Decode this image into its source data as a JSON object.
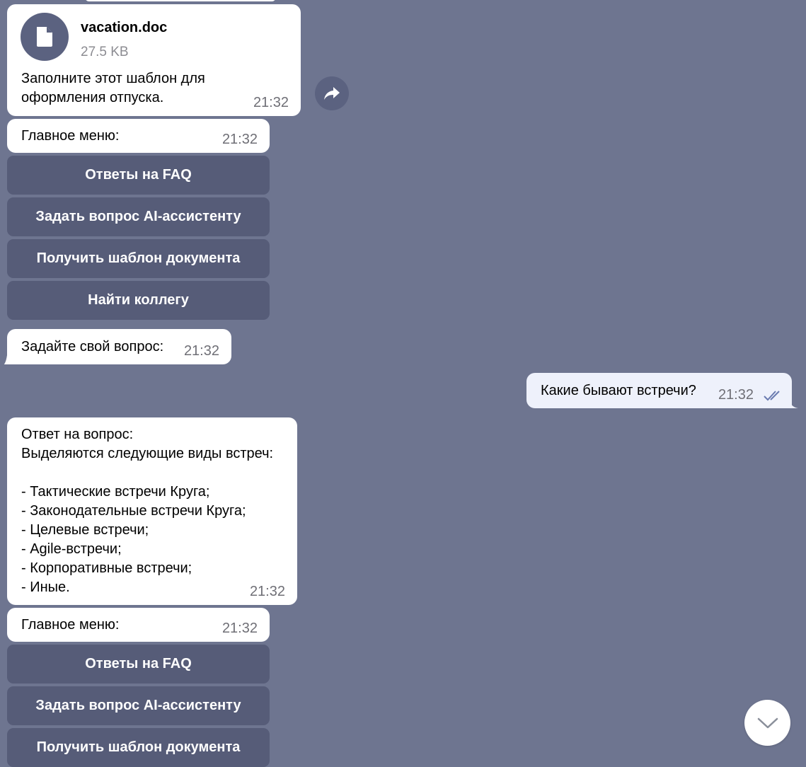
{
  "file_message": {
    "file_name": "vacation.doc",
    "file_size": "27.5 KB",
    "caption": "Заполните этот шаблон для\nоформления отпуска.",
    "time": "21:32"
  },
  "menu_1": {
    "text": "Главное меню:",
    "time": "21:32",
    "buttons": [
      "Ответы на FAQ",
      "Задать вопрос AI-ассистенту",
      "Получить шаблон документа",
      "Найти коллегу"
    ]
  },
  "prompt_message": {
    "text": "Задайте свой вопрос:",
    "time": "21:32"
  },
  "user_message": {
    "text": "Какие бывают встречи?",
    "time": "21:32"
  },
  "answer_message": {
    "text": "Ответ на вопрос:\nВыделяются следующие виды встреч:\n\n- Тактические встречи Круга;\n- Законодательные встречи Круга;\n- Целевые встречи;\n- Agile-встречи;\n- Корпоративные встречи;\n- Иные.",
    "time": "21:32"
  },
  "menu_2": {
    "text": "Главное меню:",
    "time": "21:32",
    "buttons": [
      "Ответы на FAQ",
      "Задать вопрос AI-ассистенту",
      "Получить шаблон документа"
    ]
  },
  "icons": {
    "forward": "share-arrow-icon",
    "scroll_down": "chevron-down-icon",
    "file": "document-icon",
    "read_status": "double-check-icon"
  },
  "colors": {
    "background": "#6e7590",
    "keyboard_button": "#565c78",
    "incoming_bubble": "#ffffff",
    "outgoing_bubble": "#eef1fb",
    "read_check": "#6a7bb0"
  }
}
